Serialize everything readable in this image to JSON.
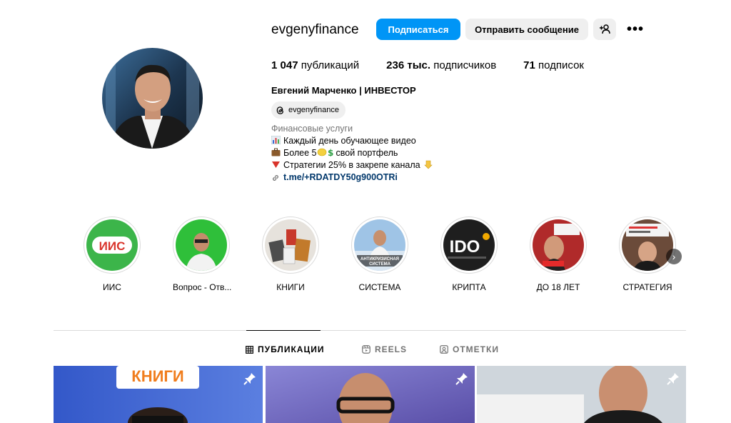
{
  "profile": {
    "username": "evgenyfinance",
    "follow_label": "Подписаться",
    "message_label": "Отправить сообщение",
    "add_user_icon": "add-user-icon",
    "more_icon": "more-options-icon",
    "more_label": "•••"
  },
  "stats": {
    "posts_count": "1 047",
    "posts_label": "публикаций",
    "followers_count": "236 тыс.",
    "followers_label": "подписчиков",
    "following_count": "71",
    "following_label": "подписок"
  },
  "bio": {
    "full_name": "Евгений Марченко | ИНВЕСТОР",
    "threads_handle": "evgenyfinance",
    "category": "Финансовые услуги",
    "line1": "Каждый день обучающее видео",
    "line2_a": "Более 5",
    "line2_b": "свой портфель",
    "line3": "Стратегии 25% в закрепе канала",
    "link": "t.me/+RDATDY50g900OTRi"
  },
  "highlights": [
    {
      "label": "ИИС",
      "badge": "ИИС"
    },
    {
      "label": "Вопрос - Отв..."
    },
    {
      "label": "КНИГИ"
    },
    {
      "label": "СИСТЕМА",
      "caption": "АНТИКРИЗИСНАЯ СИСТЕМА"
    },
    {
      "label": "КРИПТА",
      "caption": "IDO"
    },
    {
      "label": "ДО 18 ЛЕТ"
    },
    {
      "label": "СТРАТЕГИЯ"
    }
  ],
  "tabs": [
    {
      "label": "ПУБЛИКАЦИИ",
      "icon": "grid-icon",
      "active": true
    },
    {
      "label": "REELS",
      "icon": "reels-icon",
      "active": false
    },
    {
      "label": "ОТМЕТКИ",
      "icon": "tagged-icon",
      "active": false
    }
  ],
  "posts": [
    {
      "overlay_text": "КНИГИ",
      "pinned": true
    },
    {
      "pinned": true
    },
    {
      "pinned": true
    }
  ],
  "colors": {
    "accent": "#0095f6",
    "link": "#00376b",
    "muted": "#737373",
    "button_gray": "#efefef"
  }
}
